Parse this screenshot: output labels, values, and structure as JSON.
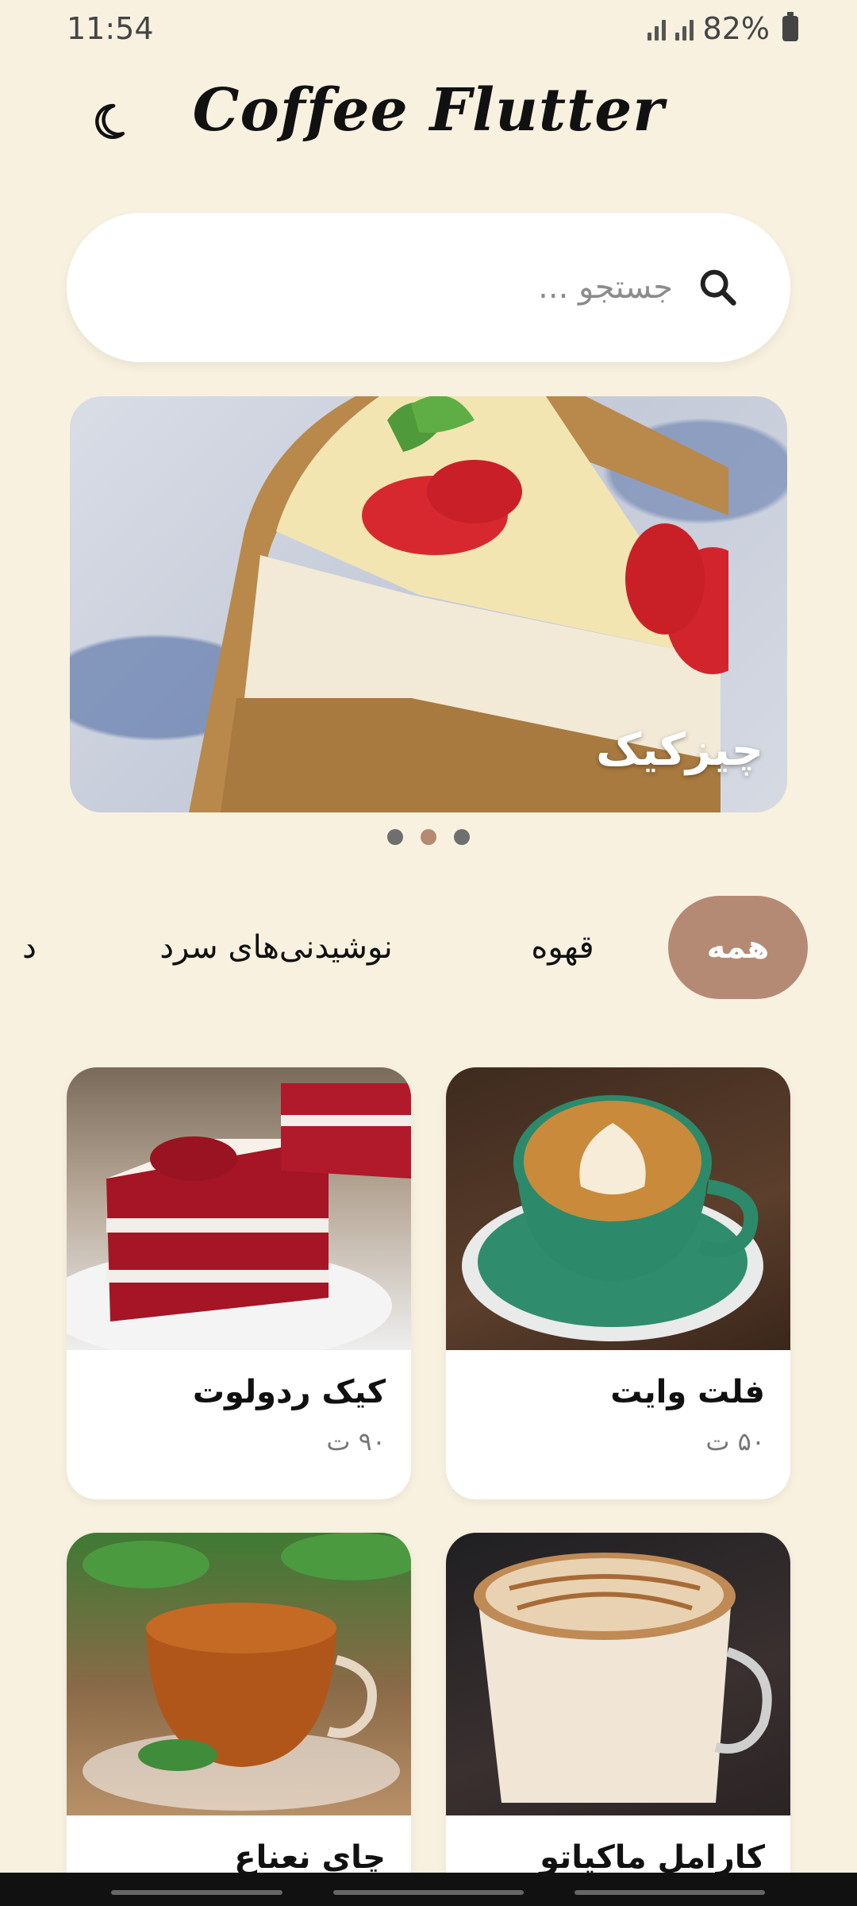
{
  "status": {
    "time": "11:54",
    "battery": "82%"
  },
  "header": {
    "title": "Coffee Flutter",
    "theme_icon": "moon-icon"
  },
  "search": {
    "placeholder": "جستجو ..."
  },
  "banner": {
    "label": "چیزکیک",
    "slides": 3,
    "active_slide": 2
  },
  "tabs": [
    {
      "label": "همه",
      "active": true
    },
    {
      "label": "قهوه",
      "active": false
    },
    {
      "label": "نوشیدنی‌های سرد",
      "active": false
    },
    {
      "label": "د",
      "active": false
    }
  ],
  "products": [
    {
      "name": "فلت وایت",
      "price": "۵۰ ت"
    },
    {
      "name": "کیک ردولوت",
      "price": "۹۰ ت"
    },
    {
      "name": "کارامل ماکیاتو",
      "price": ""
    },
    {
      "name": "چای نعناع",
      "price": ""
    }
  ],
  "colors": {
    "background": "#f8f1e0",
    "accent": "#b58a74",
    "card": "#ffffff"
  }
}
